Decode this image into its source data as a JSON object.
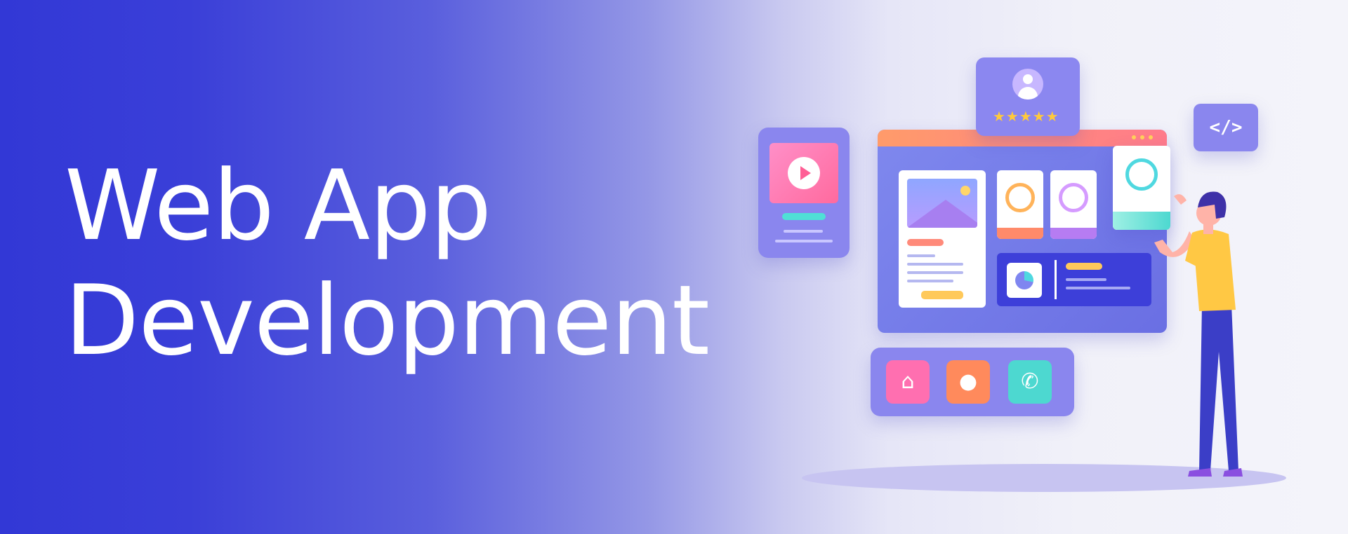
{
  "banner": {
    "headline_line1": "Web App",
    "headline_line2": "Development"
  },
  "illustration": {
    "code_tag": "</>",
    "rating_stars": "★★★★★",
    "rating_count": 5,
    "dock_icons": [
      "home-icon",
      "location-pin-icon",
      "phone-icon"
    ]
  },
  "colors": {
    "gradient_left": "#3238d6",
    "gradient_right": "#f4f4fa",
    "accent_purple": "#8a86ee",
    "accent_pink": "#ff6a9e",
    "accent_orange": "#ff8a5c",
    "accent_teal": "#4dd8d0",
    "star_yellow": "#ffc93c"
  }
}
